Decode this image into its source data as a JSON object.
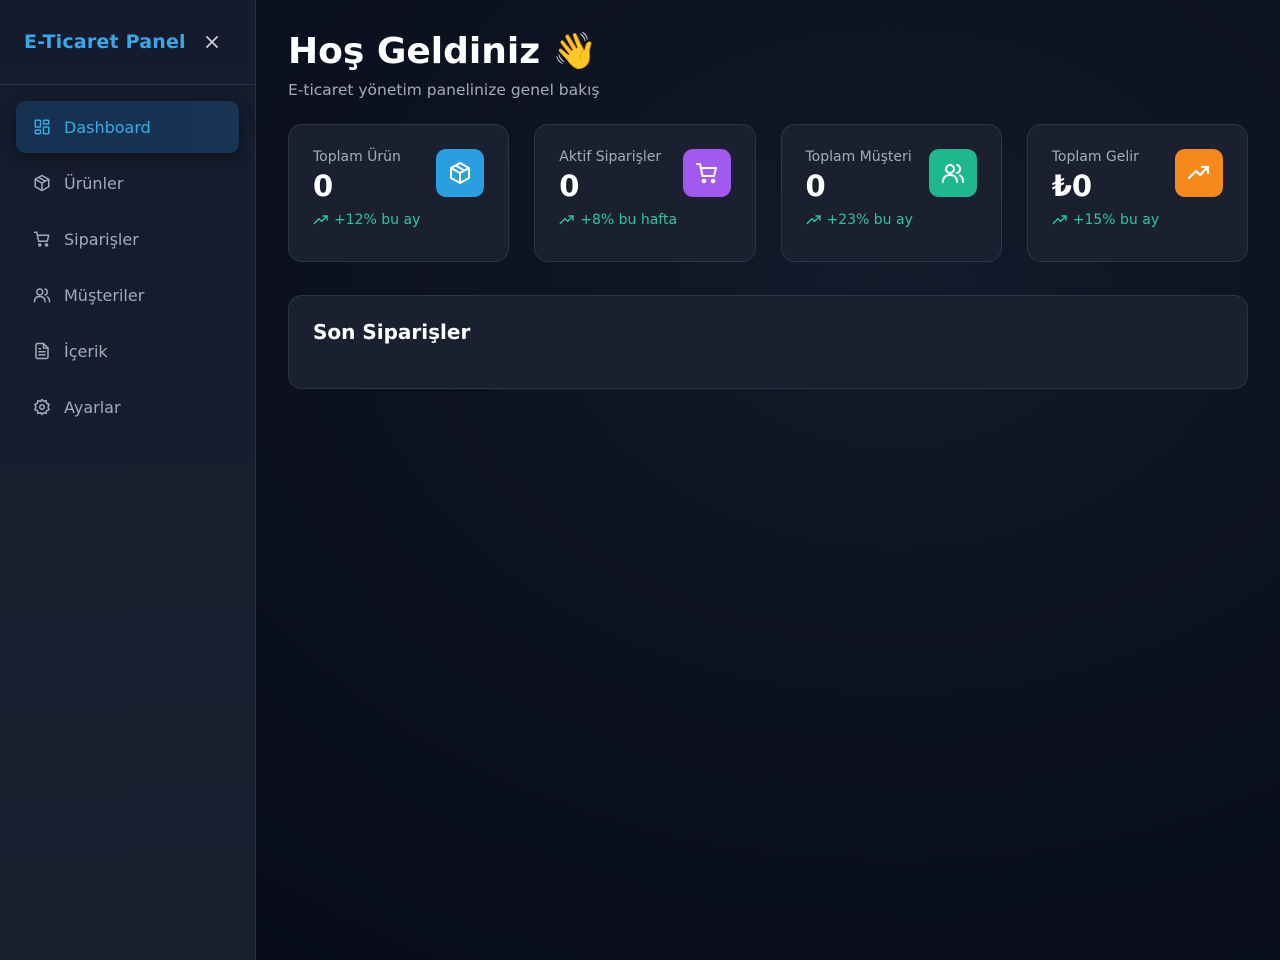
{
  "sidebar": {
    "brand": "E-Ticaret Panel",
    "items": [
      {
        "label": "Dashboard",
        "icon": "dashboard-icon",
        "active": true
      },
      {
        "label": "Ürünler",
        "icon": "box-icon"
      },
      {
        "label": "Siparişler",
        "icon": "cart-icon"
      },
      {
        "label": "Müşteriler",
        "icon": "users-icon"
      },
      {
        "label": "İçerik",
        "icon": "document-icon"
      },
      {
        "label": "Ayarlar",
        "icon": "gear-icon"
      }
    ]
  },
  "header": {
    "title": "Hoş Geldiniz 👋",
    "subtitle": "E-ticaret yönetim panelinize genel bakış"
  },
  "stats": [
    {
      "label": "Toplam Ürün",
      "value": "0",
      "trend": "+12% bu ay",
      "icon": "box-icon",
      "color": "#2a9fe0"
    },
    {
      "label": "Aktif Siparişler",
      "value": "0",
      "trend": "+8% bu hafta",
      "icon": "cart-icon",
      "color": "#a259f0"
    },
    {
      "label": "Toplam Müşteri",
      "value": "0",
      "trend": "+23% bu ay",
      "icon": "users-icon",
      "color": "#1fb88e"
    },
    {
      "label": "Toplam Gelir",
      "value": "₺0",
      "trend": "+15% bu ay",
      "icon": "trending-up-icon",
      "color": "#f5891b"
    }
  ],
  "recent_orders": {
    "title": "Son Siparişler"
  },
  "colors": {
    "accent": "#38a8e8",
    "trend_positive": "#2ec4a0"
  }
}
